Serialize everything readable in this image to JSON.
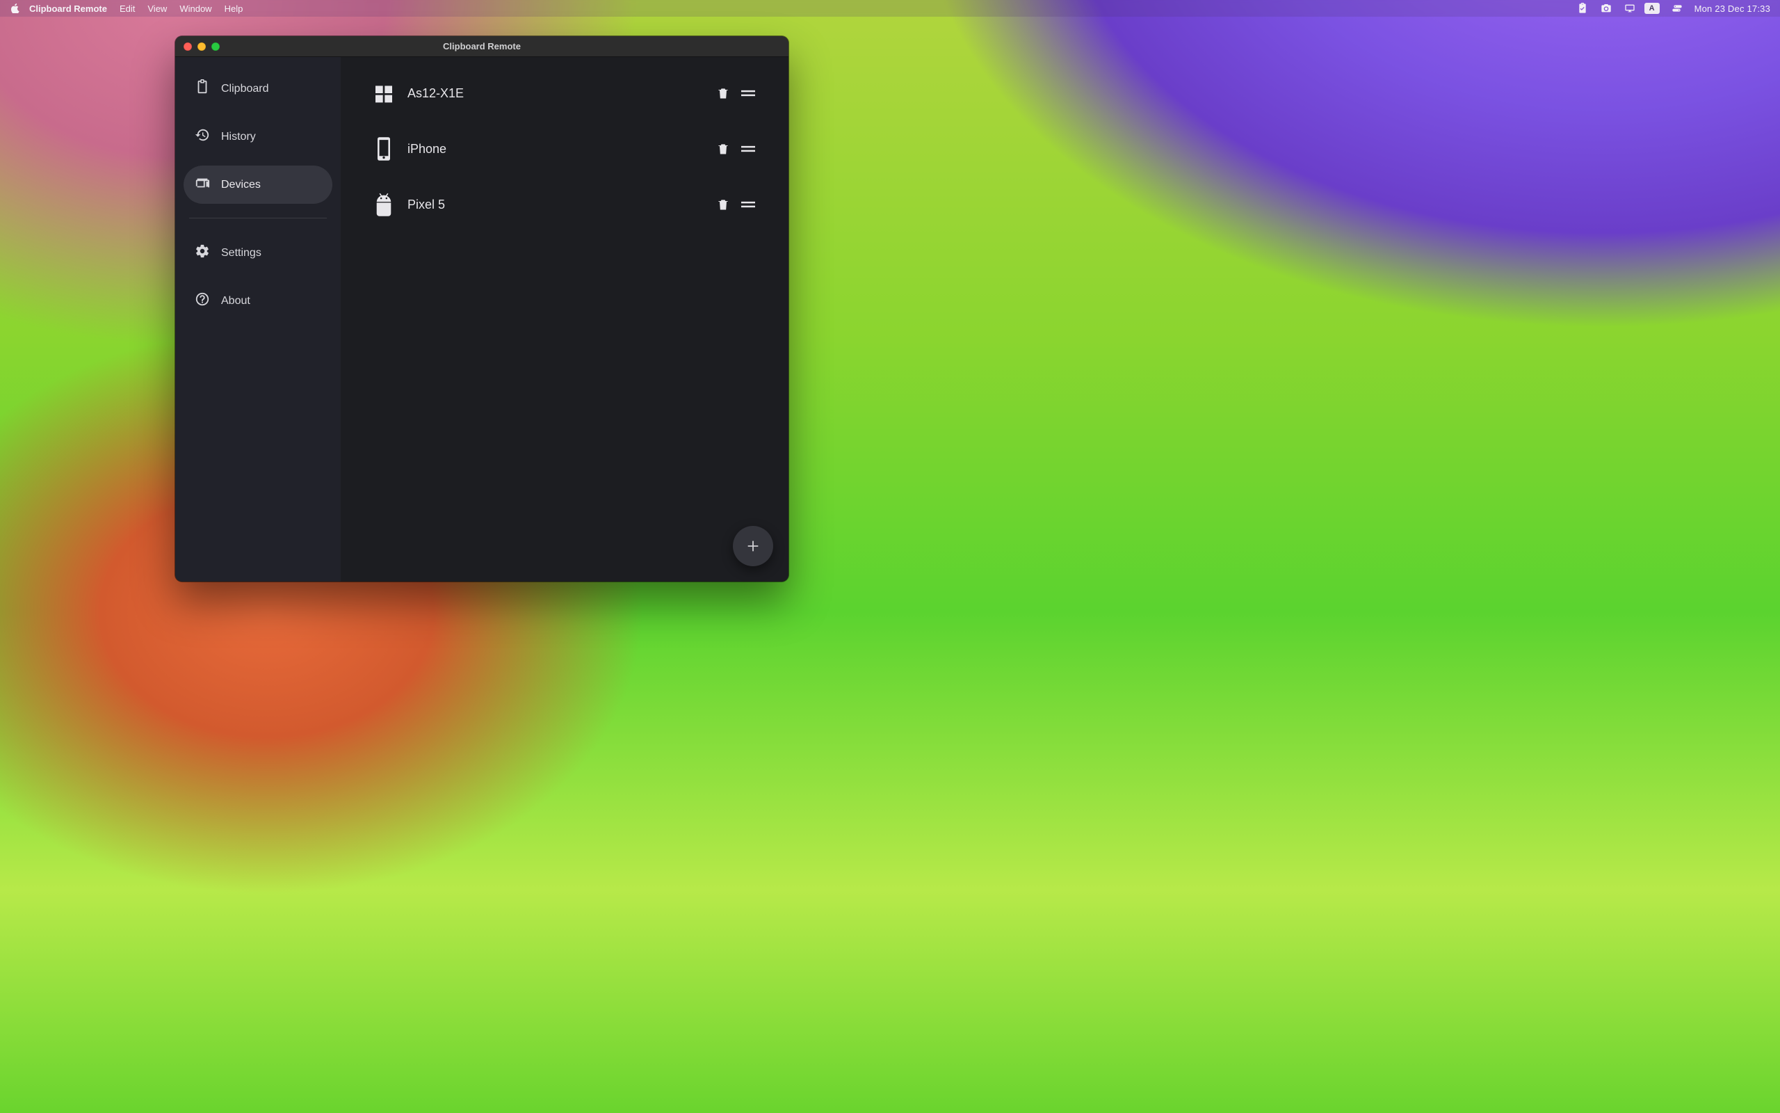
{
  "menubar": {
    "app_name": "Clipboard Remote",
    "items": [
      "Edit",
      "View",
      "Window",
      "Help"
    ],
    "status_box_label": "A",
    "clock": "Mon 23 Dec  17:33"
  },
  "window": {
    "title": "Clipboard Remote"
  },
  "sidebar": {
    "items": [
      {
        "id": "clipboard",
        "label": "Clipboard",
        "icon": "clipboard-icon",
        "active": false
      },
      {
        "id": "history",
        "label": "History",
        "icon": "history-icon",
        "active": false
      },
      {
        "id": "devices",
        "label": "Devices",
        "icon": "devices-icon",
        "active": true
      }
    ],
    "secondary": [
      {
        "id": "settings",
        "label": "Settings",
        "icon": "gear-icon"
      },
      {
        "id": "about",
        "label": "About",
        "icon": "help-icon"
      }
    ]
  },
  "devices": [
    {
      "name": "As12-X1E",
      "platform": "windows"
    },
    {
      "name": "iPhone",
      "platform": "ios"
    },
    {
      "name": "Pixel 5",
      "platform": "android"
    }
  ]
}
